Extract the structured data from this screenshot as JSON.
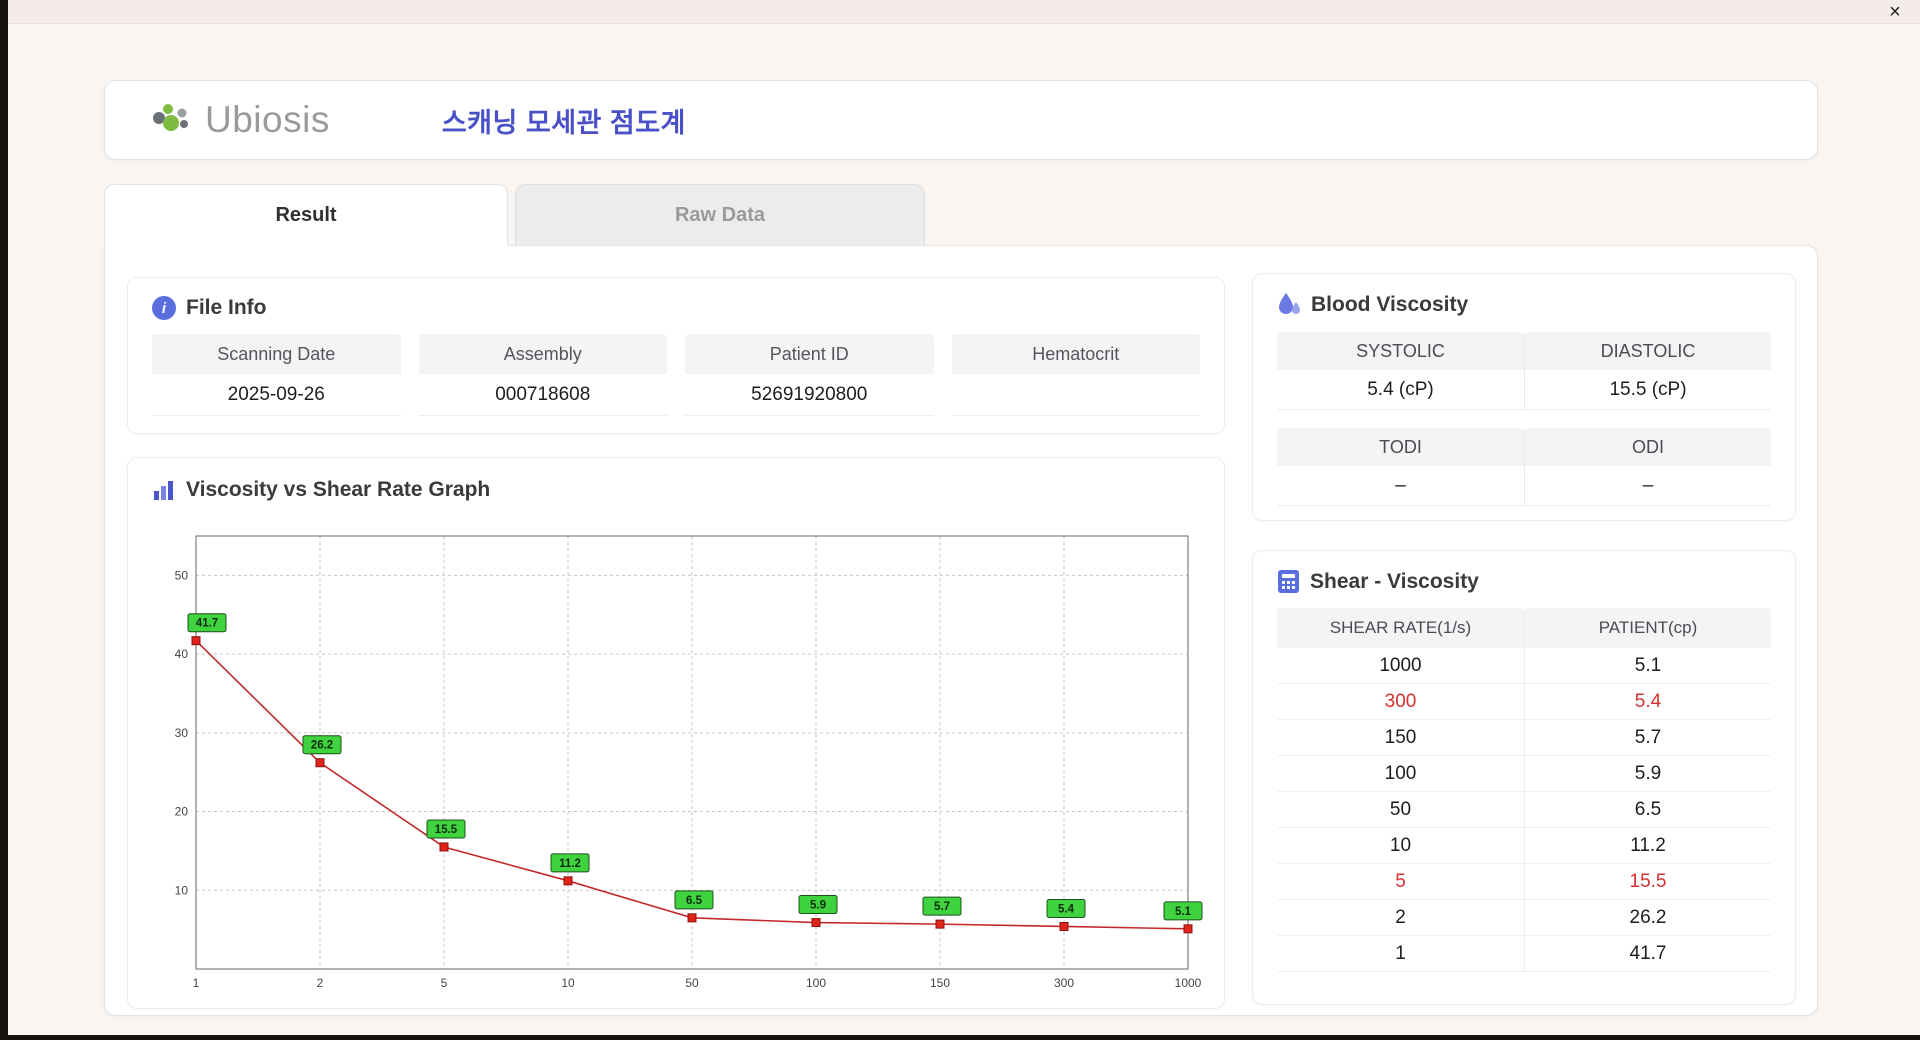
{
  "window": {
    "close_label": "×"
  },
  "header": {
    "brand": "Ubiosis",
    "title": "스캐닝 모세관 점도계"
  },
  "tabs": [
    {
      "label": "Result",
      "active": true
    },
    {
      "label": "Raw Data",
      "active": false
    }
  ],
  "file_info": {
    "title": "File Info",
    "fields": [
      {
        "label": "Scanning Date",
        "value": "2025-09-26"
      },
      {
        "label": "Assembly",
        "value": "000718608"
      },
      {
        "label": "Patient ID",
        "value": "52691920800"
      },
      {
        "label": "Hematocrit",
        "value": ""
      }
    ]
  },
  "blood_viscosity": {
    "title": "Blood Viscosity",
    "cells": [
      {
        "label": "SYSTOLIC",
        "value": "5.4 (cP)"
      },
      {
        "label": "DIASTOLIC",
        "value": "15.5 (cP)"
      },
      {
        "label": "TODI",
        "value": "–"
      },
      {
        "label": "ODI",
        "value": "–"
      }
    ]
  },
  "graph": {
    "title": "Viscosity vs Shear Rate Graph"
  },
  "chart_data": {
    "type": "line",
    "title": "Viscosity vs Shear Rate Graph",
    "x": [
      1,
      2,
      5,
      10,
      50,
      100,
      150,
      300,
      1000
    ],
    "values": [
      41.7,
      26.2,
      15.5,
      11.2,
      6.5,
      5.9,
      5.7,
      5.4,
      5.1
    ],
    "xlabel": "",
    "ylabel": "",
    "ylim": [
      0,
      55
    ],
    "yticks": [
      10,
      20,
      30,
      40,
      50
    ],
    "x_axis_note": "log-like scale, ticks equally spaced",
    "grid": "dashed",
    "line_color": "#c22a2a",
    "marker_color": "#e02418",
    "label_bg": "#3fd43f",
    "legend": "none"
  },
  "shear_table": {
    "title": "Shear - Viscosity",
    "columns": [
      "SHEAR RATE(1/s)",
      "PATIENT(cp)"
    ],
    "rows": [
      {
        "shear": "1000",
        "patient": "5.1",
        "highlight": false
      },
      {
        "shear": "300",
        "patient": "5.4",
        "highlight": true
      },
      {
        "shear": "150",
        "patient": "5.7",
        "highlight": false
      },
      {
        "shear": "100",
        "patient": "5.9",
        "highlight": false
      },
      {
        "shear": "50",
        "patient": "6.5",
        "highlight": false
      },
      {
        "shear": "10",
        "patient": "11.2",
        "highlight": false
      },
      {
        "shear": "5",
        "patient": "15.5",
        "highlight": true
      },
      {
        "shear": "2",
        "patient": "26.2",
        "highlight": false
      },
      {
        "shear": "1",
        "patient": "41.7",
        "highlight": false
      }
    ]
  }
}
